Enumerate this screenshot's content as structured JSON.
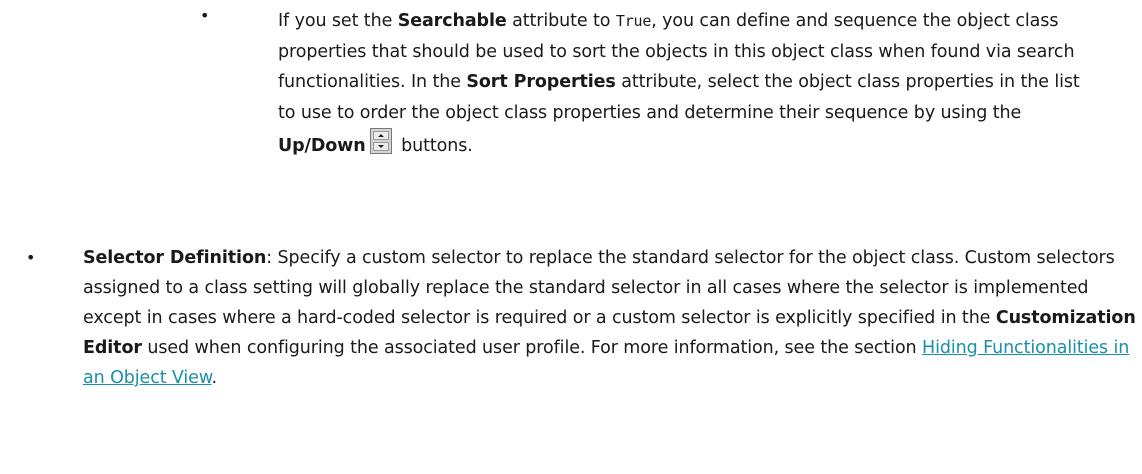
{
  "colors": {
    "text": "#1a1a1a",
    "link": "#1a8fa8",
    "background": "#ffffff"
  },
  "bullet_char": "•",
  "sub_bullet": {
    "t1": "If you set the ",
    "b1": "Searchable",
    "t2": " attribute to ",
    "code1": "True",
    "t3": ", you can define and sequence the object class properties that should be used to sort the objects in this object class when found via search functionalities. In the ",
    "b2": "Sort Properties",
    "t4": " attribute, select the object class properties in the list to use to order the object class properties and determine their sequence by using the ",
    "b3": "Up/Down",
    "icon": "up-down-spinner-icon",
    "t5": " buttons."
  },
  "selector_bullet": {
    "b1": "Selector Definition",
    "t1": ": Specify a custom selector to replace the standard selector for the object class. Custom selectors assigned to a class setting will globally replace the standard selector in all cases where the selector is implemented except in cases where a hard-coded selector is required or a custom selector is explicitly specified in the ",
    "b2": "Customization Editor",
    "t2": " used when configuring the associated user profile. For more information, see the section ",
    "link_text": "Hiding Functionalities in an Object View",
    "t3": "."
  }
}
